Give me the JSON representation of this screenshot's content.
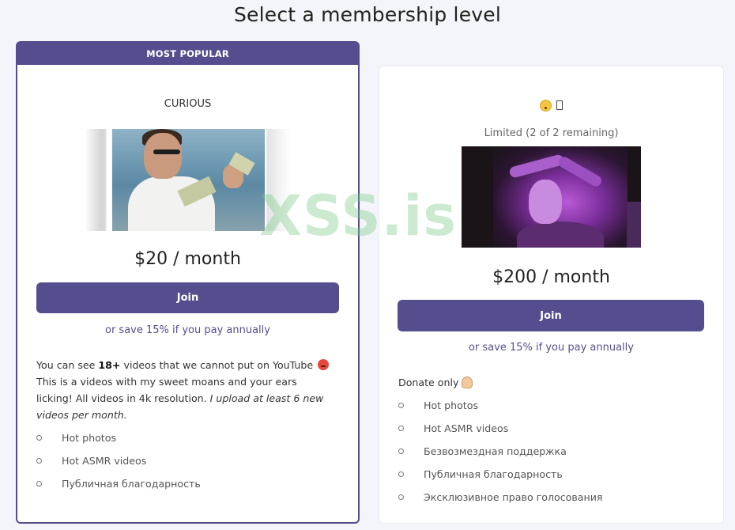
{
  "page": {
    "title": "Select a membership level"
  },
  "tiers": [
    {
      "ribbon": "MOST POPULAR",
      "name": "CURIOUS",
      "price": "$20 / month",
      "join_label": "Join",
      "save_text": "or save 15% if you pay annually",
      "description": {
        "part1": "You can see ",
        "bold": "18+",
        "part2": " videos that we cannot put on YouTube",
        "part3": "This is a videos with my sweet moans and your ears licking! All videos in 4k resolution. ",
        "italic": "I upload at least 6 new videos per month."
      },
      "benefits": [
        "Hot photos",
        "Hot ASMR videos",
        "Публичная благодарность"
      ]
    },
    {
      "name_icon": "hushed-face-emoji",
      "limited": "Limited (2 of 2 remaining)",
      "price": "$200 / month",
      "join_label": "Join",
      "save_text": "or save 15% if you pay annually",
      "description": "Donate only",
      "benefits": [
        "Hot photos",
        "Hot ASMR videos",
        "Безвозмездная поддержка",
        "Публичная благодарность",
        "Эксклюзивное право голосования"
      ]
    }
  ],
  "watermark": "XSS.is",
  "colors": {
    "accent": "#544e8e",
    "background": "#f4f5fa"
  }
}
